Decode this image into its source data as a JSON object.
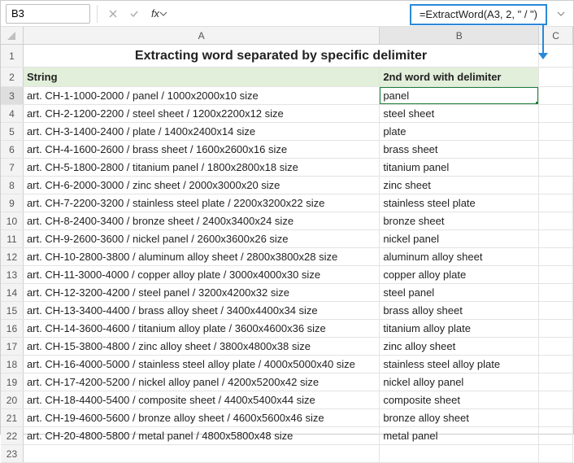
{
  "namebox": {
    "value": "B3"
  },
  "formula_bar": {
    "value": "",
    "highlight": "=ExtractWord(A3, 2, \" / \")"
  },
  "columns": {
    "a": "A",
    "b": "B",
    "c": "C"
  },
  "title": "Extracting word separated by specific delimiter",
  "headers": {
    "string": "String",
    "word": "2nd word with delimiter"
  },
  "rows": [
    {
      "n": "3",
      "a": "art. CH-1-1000-2000 / panel / 1000x2000x10 size",
      "b": "panel"
    },
    {
      "n": "4",
      "a": "art. CH-2-1200-2200 / steel sheet / 1200x2200x12 size",
      "b": "steel sheet"
    },
    {
      "n": "5",
      "a": "art. CH-3-1400-2400 / plate / 1400x2400x14 size",
      "b": "plate"
    },
    {
      "n": "6",
      "a": "art. CH-4-1600-2600 / brass sheet / 1600x2600x16 size",
      "b": "brass sheet"
    },
    {
      "n": "7",
      "a": "art. CH-5-1800-2800 / titanium panel / 1800x2800x18 size",
      "b": "titanium panel"
    },
    {
      "n": "8",
      "a": "art. CH-6-2000-3000 / zinc sheet / 2000x3000x20 size",
      "b": "zinc sheet"
    },
    {
      "n": "9",
      "a": "art. CH-7-2200-3200 / stainless steel plate / 2200x3200x22 size",
      "b": "stainless steel plate"
    },
    {
      "n": "10",
      "a": "art. CH-8-2400-3400 / bronze sheet / 2400x3400x24 size",
      "b": "bronze sheet"
    },
    {
      "n": "11",
      "a": "art. CH-9-2600-3600 / nickel panel / 2600x3600x26 size",
      "b": "nickel panel"
    },
    {
      "n": "12",
      "a": "art. CH-10-2800-3800 / aluminum alloy sheet / 2800x3800x28 size",
      "b": "aluminum alloy sheet"
    },
    {
      "n": "13",
      "a": "art. CH-11-3000-4000 / copper alloy plate / 3000x4000x30 size",
      "b": "copper alloy plate"
    },
    {
      "n": "14",
      "a": "art. CH-12-3200-4200 / steel panel / 3200x4200x32 size",
      "b": "steel panel"
    },
    {
      "n": "15",
      "a": "art. CH-13-3400-4400 / brass alloy sheet / 3400x4400x34 size",
      "b": "brass alloy sheet"
    },
    {
      "n": "16",
      "a": "art. CH-14-3600-4600 / titanium alloy plate / 3600x4600x36 size",
      "b": "titanium alloy plate"
    },
    {
      "n": "17",
      "a": "art. CH-15-3800-4800 / zinc alloy sheet / 3800x4800x38 size",
      "b": "zinc alloy sheet"
    },
    {
      "n": "18",
      "a": "art. CH-16-4000-5000 / stainless steel alloy plate / 4000x5000x40 size",
      "b": "stainless steel alloy plate"
    },
    {
      "n": "19",
      "a": "art. CH-17-4200-5200 / nickel alloy panel / 4200x5200x42 size",
      "b": "nickel alloy panel"
    },
    {
      "n": "20",
      "a": "art. CH-18-4400-5400 / composite sheet / 4400x5400x44 size",
      "b": "composite sheet"
    },
    {
      "n": "21",
      "a": "art. CH-19-4600-5600 / bronze alloy sheet / 4600x5600x46 size",
      "b": "bronze alloy sheet"
    },
    {
      "n": "22",
      "a": "art. CH-20-4800-5800 / metal panel / 4800x5800x48 size",
      "b": "metal panel"
    }
  ],
  "empty_row": {
    "n": "23"
  }
}
